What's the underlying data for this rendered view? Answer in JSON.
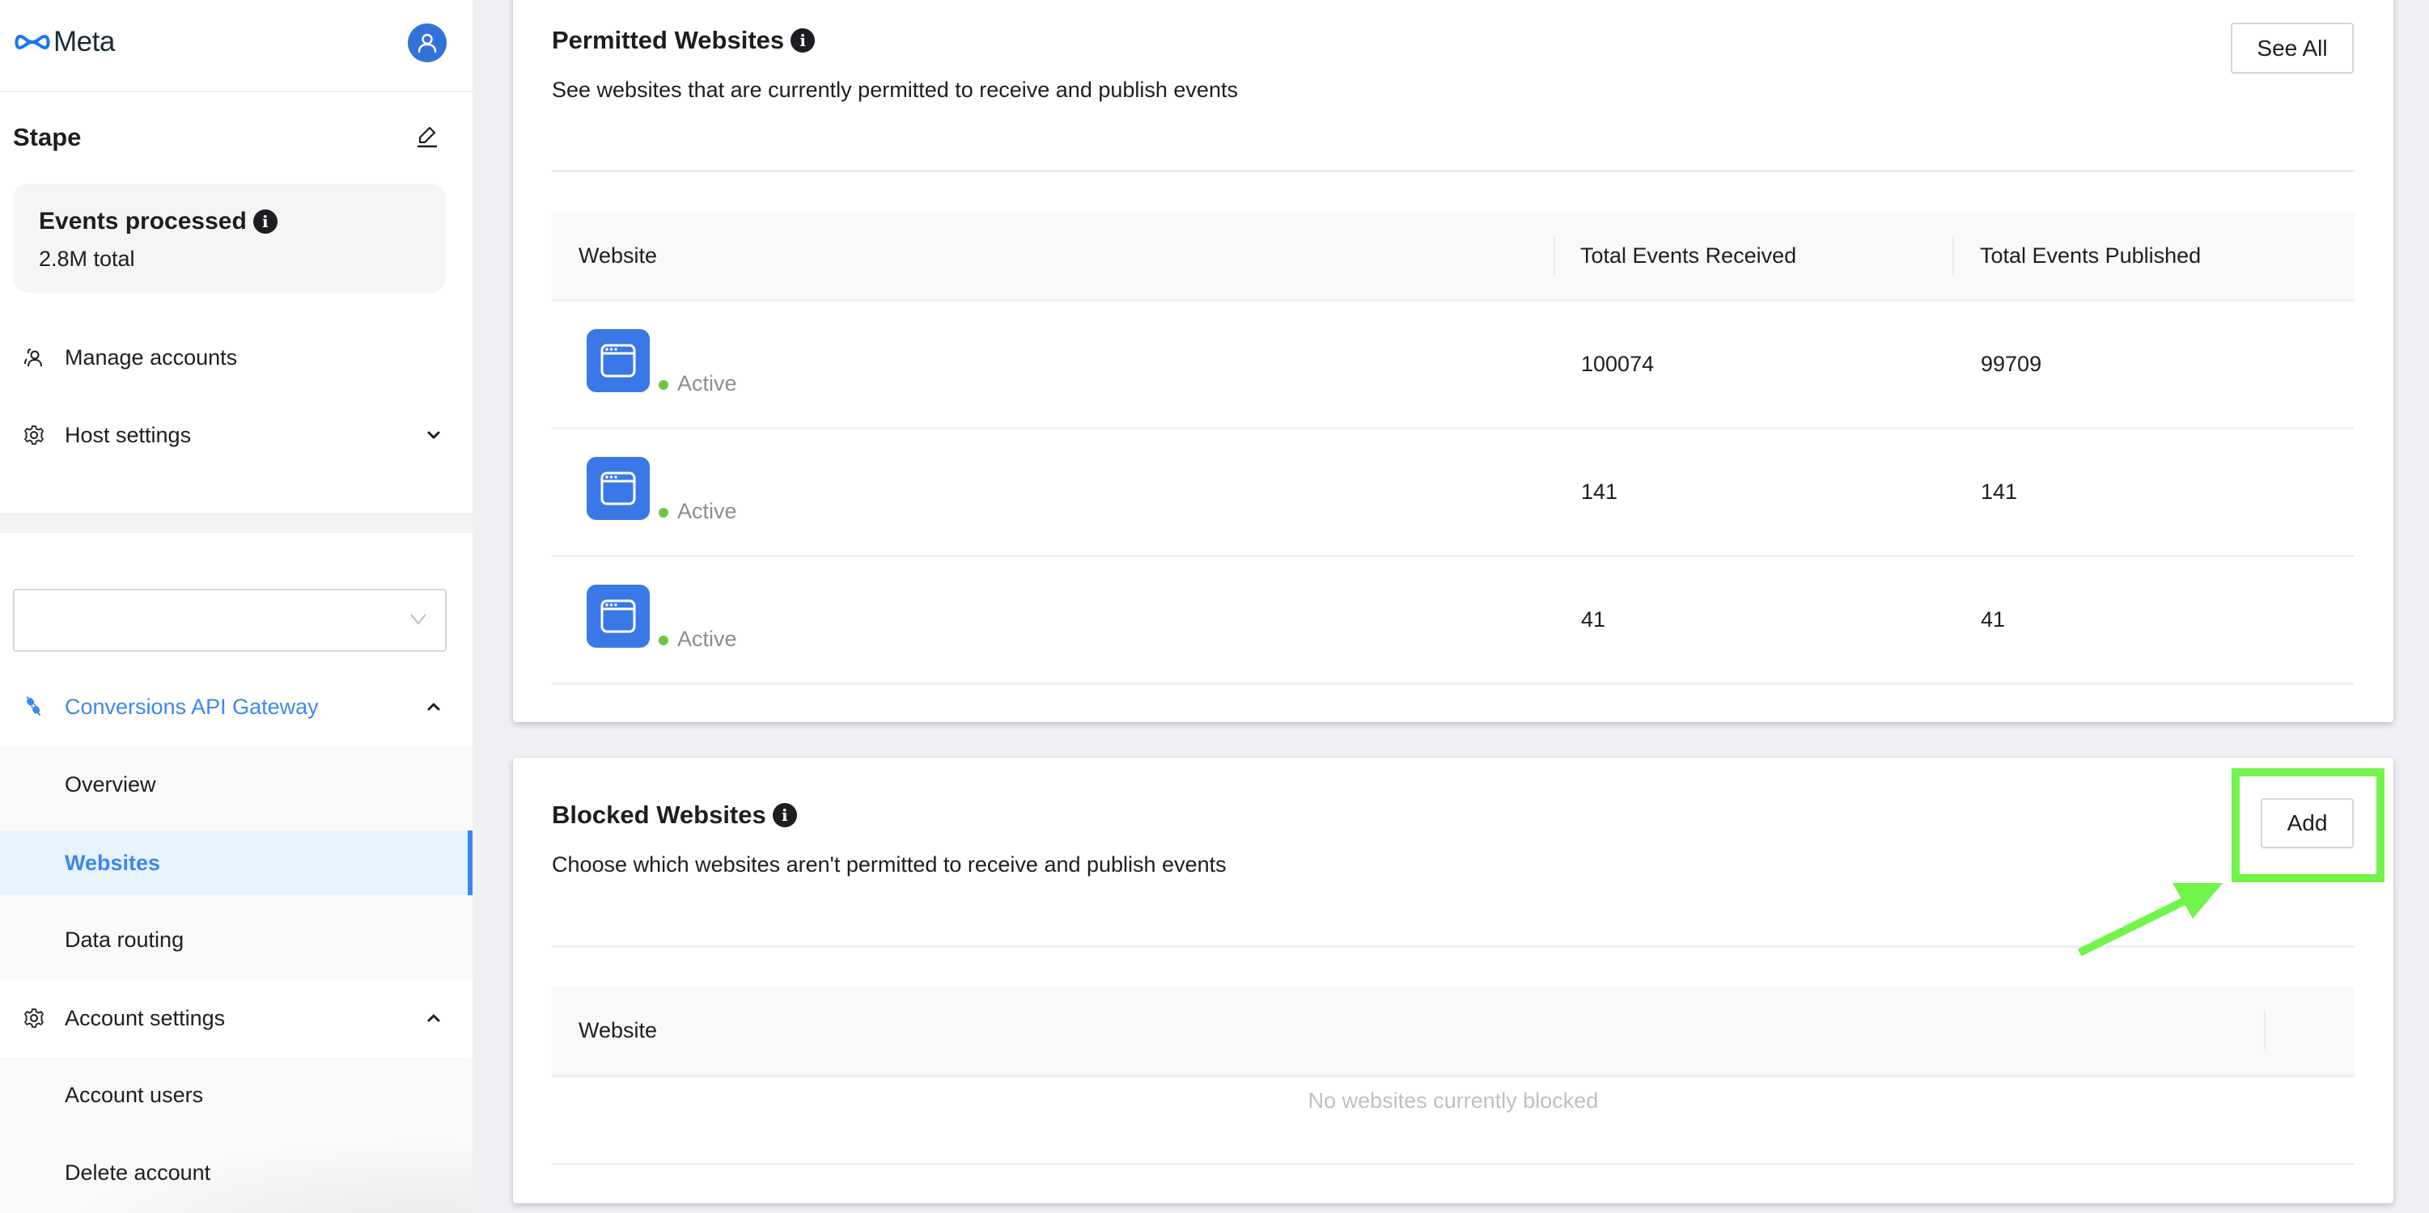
{
  "sidebar": {
    "brand": "Meta",
    "account_name": "Stape",
    "events": {
      "title": "Events processed",
      "value": "2.8M total",
      "info_icon": "i"
    },
    "top_nav": [
      {
        "label": "Manage accounts",
        "icon": "people-icon"
      },
      {
        "label": "Host settings",
        "icon": "gear-icon",
        "expanded": false
      }
    ],
    "account_select": {
      "value": "",
      "placeholder": ""
    },
    "sections": [
      {
        "label": "Conversions API Gateway",
        "icon": "plug-icon",
        "expanded": true,
        "items": [
          {
            "label": "Overview",
            "active": false
          },
          {
            "label": "Websites",
            "active": true
          },
          {
            "label": "Data routing",
            "active": false
          }
        ]
      },
      {
        "label": "Account settings",
        "icon": "gear-icon",
        "expanded": true,
        "items": [
          {
            "label": "Account users",
            "active": false
          },
          {
            "label": "Delete account",
            "active": false
          }
        ]
      }
    ]
  },
  "permitted": {
    "title": "Permitted Websites",
    "info_icon": "i",
    "description": "See websites that are currently permitted to receive and publish events",
    "see_all_label": "See All",
    "columns": [
      "Website",
      "Total Events Received",
      "Total Events Published"
    ],
    "rows": [
      {
        "status": "Active",
        "received": "100074",
        "published": "99709"
      },
      {
        "status": "Active",
        "received": "141",
        "published": "141"
      },
      {
        "status": "Active",
        "received": "41",
        "published": "41"
      }
    ]
  },
  "blocked": {
    "title": "Blocked Websites",
    "info_icon": "i",
    "description": "Choose which websites aren't permitted to receive and publish events",
    "add_label": "Add",
    "columns": [
      "Website"
    ],
    "empty_message": "No websites currently blocked"
  },
  "colors": {
    "accent": "#3e86f0",
    "status_active": "#6cc644",
    "annotation": "#72f54a",
    "site_icon": "#3b78e7"
  }
}
